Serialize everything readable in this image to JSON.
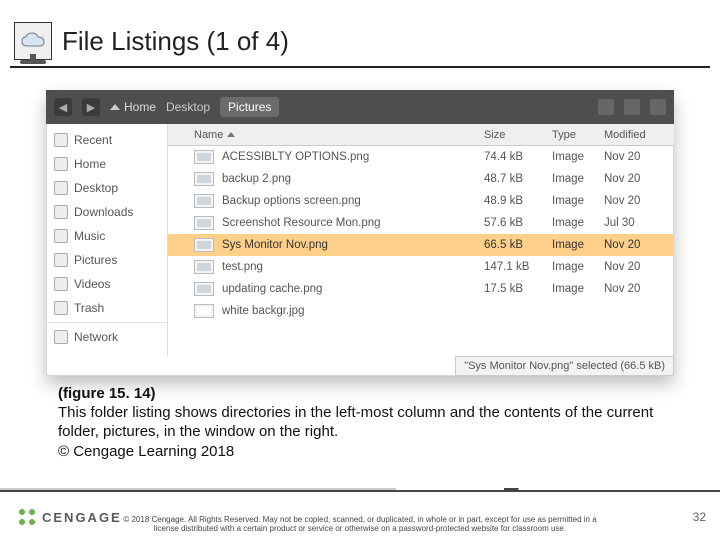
{
  "title": "File Listings (1 of 4)",
  "breadcrumbs": {
    "home": "Home",
    "desktop": "Desktop",
    "current": "Pictures"
  },
  "places": [
    "Recent",
    "Home",
    "Desktop",
    "Downloads",
    "Music",
    "Pictures",
    "Videos",
    "Trash",
    "Network"
  ],
  "columns": {
    "name": "Name",
    "size": "Size",
    "type": "Type",
    "modified": "Modified"
  },
  "files": [
    {
      "name": "ACESSIBLTY OPTIONS.png",
      "size": "74.4 kB",
      "type": "Image",
      "modified": "Nov 20"
    },
    {
      "name": "backup 2.png",
      "size": "48.7 kB",
      "type": "Image",
      "modified": "Nov 20"
    },
    {
      "name": "Backup options screen.png",
      "size": "48.9 kB",
      "type": "Image",
      "modified": "Nov 20"
    },
    {
      "name": "Screenshot Resource Mon.png",
      "size": "57.6 kB",
      "type": "Image",
      "modified": "Jul 30"
    },
    {
      "name": "Sys Monitor Nov.png",
      "size": "66.5 kB",
      "type": "Image",
      "modified": "Nov 20"
    },
    {
      "name": "test.png",
      "size": "147.1 kB",
      "type": "Image",
      "modified": "Nov 20"
    },
    {
      "name": "updating cache.png",
      "size": "17.5 kB",
      "type": "Image",
      "modified": "Nov 20"
    },
    {
      "name": "white backgr.jpg",
      "size": "",
      "type": "",
      "modified": ""
    }
  ],
  "selected_index": 4,
  "status_bar": "\"Sys Monitor Nov.png\" selected (66.5 kB)",
  "caption": {
    "fig": "(figure 15. 14)",
    "body1": "This folder listing shows directories in the left-most column and the contents of the current folder,  pictures, in the window on the right.",
    "cr": "© Cengage Learning 2018"
  },
  "footer_brand": "CENGAGE",
  "legal1": "© 2018 Cengage. All Rights Reserved. May not be copied, scanned, or duplicated, in whole or in part, except for use as permitted in a",
  "legal2": "license distributed with a certain product or service or otherwise on a password-protected website for classroom use.",
  "page_number": "32"
}
